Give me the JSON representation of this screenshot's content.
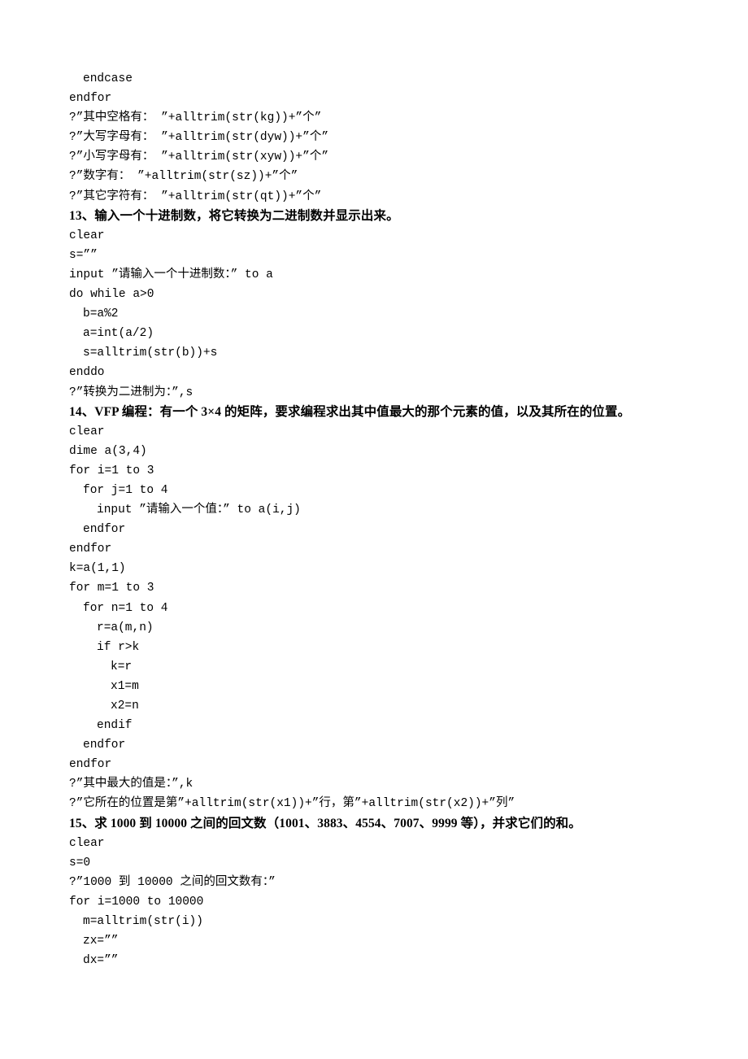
{
  "document": {
    "language": "zh-CN",
    "topic": "VFP 程序设计练习题与参考程序",
    "page_background": "#ffffff",
    "text_color": "#000000"
  },
  "blocks": [
    {
      "type": "code",
      "indent": 1,
      "text": "endcase"
    },
    {
      "type": "code",
      "indent": 0,
      "text": "endfor"
    },
    {
      "type": "code",
      "indent": 0,
      "text": "?”其中空格有： ”+alltrim(str(kg))+”个”"
    },
    {
      "type": "code",
      "indent": 0,
      "text": "?”大写字母有： ”+alltrim(str(dyw))+”个”"
    },
    {
      "type": "code",
      "indent": 0,
      "text": "?”小写字母有： ”+alltrim(str(xyw))+”个”"
    },
    {
      "type": "code",
      "indent": 0,
      "text": "?”数字有： ”+alltrim(str(sz))+”个”"
    },
    {
      "type": "code",
      "indent": 0,
      "text": "?”其它字符有： ”+alltrim(str(qt))+”个”"
    },
    {
      "type": "heading",
      "indent": 0,
      "text": "13、输入一个十进制数，将它转换为二进制数并显示出来。"
    },
    {
      "type": "code",
      "indent": 0,
      "text": "clear"
    },
    {
      "type": "code",
      "indent": 0,
      "text": "s=””"
    },
    {
      "type": "code",
      "indent": 0,
      "text": "input ”请输入一个十进制数：” to a"
    },
    {
      "type": "code",
      "indent": 0,
      "text": "do while a>0"
    },
    {
      "type": "code",
      "indent": 1,
      "text": "b=a%2"
    },
    {
      "type": "code",
      "indent": 1,
      "text": "a=int(a/2)"
    },
    {
      "type": "code",
      "indent": 1,
      "text": "s=alltrim(str(b))+s"
    },
    {
      "type": "code",
      "indent": 0,
      "text": "enddo"
    },
    {
      "type": "code",
      "indent": 0,
      "text": "?”转换为二进制为：”,s"
    },
    {
      "type": "heading",
      "indent": 0,
      "text": "14、VFP 编程：有一个 3×4 的矩阵，要求编程求出其中值最大的那个元素的值，以及其所在的位置。"
    },
    {
      "type": "code",
      "indent": 0,
      "text": "clear"
    },
    {
      "type": "code",
      "indent": 0,
      "text": "dime a(3,4)"
    },
    {
      "type": "code",
      "indent": 0,
      "text": "for i=1 to 3"
    },
    {
      "type": "code",
      "indent": 1,
      "text": "for j=1 to 4"
    },
    {
      "type": "code",
      "indent": 2,
      "text": "input ”请输入一个值：” to a(i,j)"
    },
    {
      "type": "code",
      "indent": 1,
      "text": "endfor"
    },
    {
      "type": "code",
      "indent": 0,
      "text": "endfor"
    },
    {
      "type": "code",
      "indent": 0,
      "text": "k=a(1,1)"
    },
    {
      "type": "code",
      "indent": 0,
      "text": "for m=1 to 3"
    },
    {
      "type": "code",
      "indent": 1,
      "text": "for n=1 to 4"
    },
    {
      "type": "code",
      "indent": 2,
      "text": "r=a(m,n)"
    },
    {
      "type": "code",
      "indent": 2,
      "text": "if r>k"
    },
    {
      "type": "code",
      "indent": 3,
      "text": "k=r"
    },
    {
      "type": "code",
      "indent": 3,
      "text": "x1=m"
    },
    {
      "type": "code",
      "indent": 3,
      "text": "x2=n"
    },
    {
      "type": "code",
      "indent": 2,
      "text": "endif"
    },
    {
      "type": "code",
      "indent": 1,
      "text": "endfor"
    },
    {
      "type": "code",
      "indent": 0,
      "text": "endfor"
    },
    {
      "type": "code",
      "indent": 0,
      "text": "?”其中最大的值是：”,k"
    },
    {
      "type": "code",
      "indent": 0,
      "text": "?”它所在的位置是第”+alltrim(str(x1))+”行，第”+alltrim(str(x2))+”列”"
    },
    {
      "type": "heading",
      "indent": 0,
      "text": "15、求 1000 到 10000 之间的回文数（1001、3883、4554、7007、9999 等），并求它们的和。"
    },
    {
      "type": "code",
      "indent": 0,
      "text": "clear"
    },
    {
      "type": "code",
      "indent": 0,
      "text": "s=0"
    },
    {
      "type": "code",
      "indent": 0,
      "text": "?”1000 到 10000 之间的回文数有：”"
    },
    {
      "type": "code",
      "indent": 0,
      "text": "for i=1000 to 10000"
    },
    {
      "type": "code",
      "indent": 1,
      "text": "m=alltrim(str(i))"
    },
    {
      "type": "code",
      "indent": 1,
      "text": "zx=””"
    },
    {
      "type": "code",
      "indent": 1,
      "text": "dx=””"
    }
  ]
}
